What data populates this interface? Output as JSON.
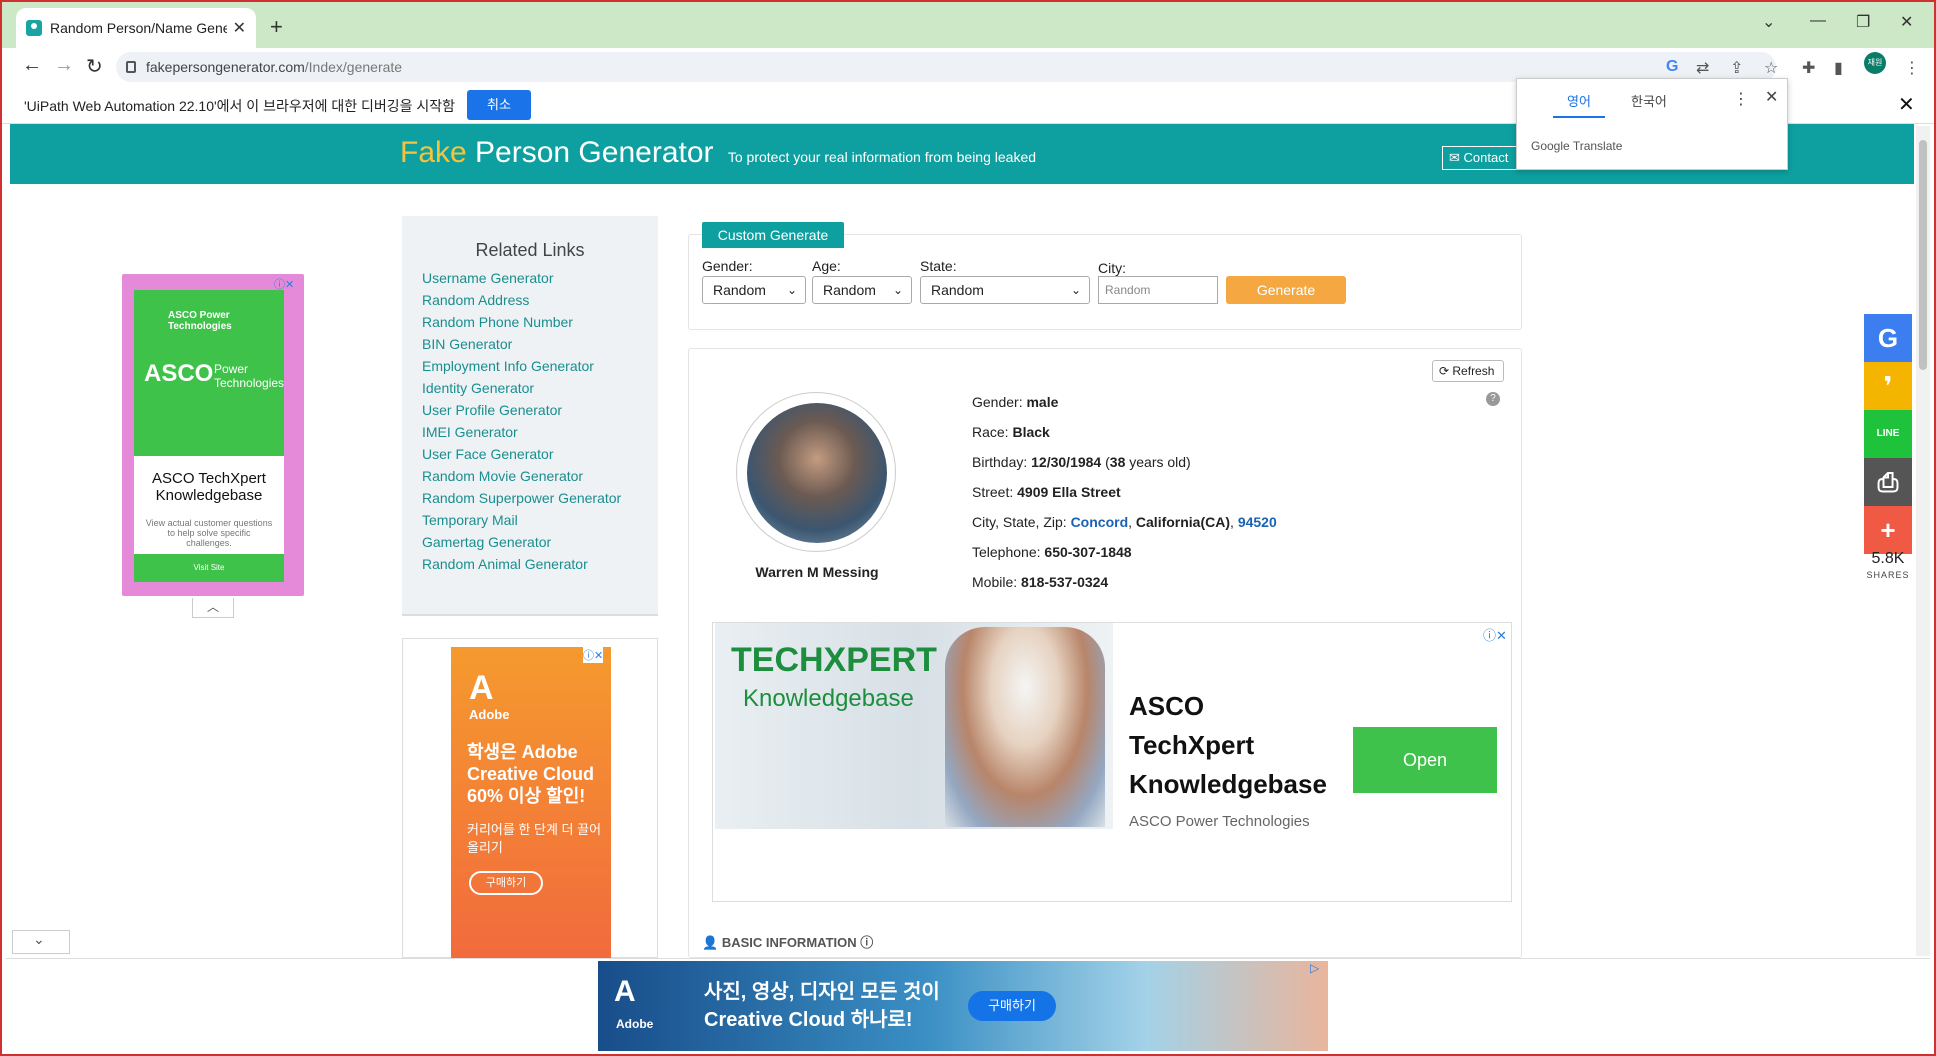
{
  "browser": {
    "tab_title": "Random Person/Name Generat",
    "tab_close": "✕",
    "new_tab": "+",
    "url_host": "fakepersongenerator.com",
    "url_path": "/Index/generate",
    "profile_label": "재원"
  },
  "debugbar": {
    "message": "'UiPath Web Automation 22.10'에서 이 브라우저에 대한 디버깅을 시작함",
    "cancel_label": "취소"
  },
  "translate": {
    "lang_source": "영어",
    "lang_target": "한국어",
    "brand": "Google Translate"
  },
  "site": {
    "brand_fake": "Fake",
    "brand_rest": "Person Generator",
    "tagline": "To protect your real information from being leaked",
    "contact_label": "Contact"
  },
  "left_ad": {
    "brand_small": "ASCO Power Technologies",
    "brand_big": "ASCO",
    "brand_power": "Power Technologies",
    "title_line1": "ASCO TechXpert",
    "title_line2": "Knowledgebase",
    "desc": "View actual customer questions to help solve specific challenges.",
    "cta": "Visit Site"
  },
  "related": {
    "heading": "Related Links",
    "links": [
      "Username Generator",
      "Random Address",
      "Random Phone Number",
      "BIN Generator",
      "Employment Info Generator",
      "Identity Generator",
      "User Profile Generator",
      "IMEI Generator",
      "User Face Generator",
      "Random Movie Generator",
      "Random Superpower Generator",
      "Temporary Mail",
      "Gamertag Generator",
      "Random Animal Generator"
    ]
  },
  "adobe_ad": {
    "brand": "Adobe",
    "headline": "학생은 Adobe Creative Cloud 60% 이상 할인!",
    "sub": "커리어를 한 단계 더 끌어올리기",
    "cta": "구매하기"
  },
  "custom": {
    "tab_label": "Custom Generate",
    "gender_label": "Gender:",
    "gender_value": "Random",
    "age_label": "Age:",
    "age_value": "Random",
    "state_label": "State:",
    "state_value": "Random",
    "city_label": "City:",
    "city_placeholder": "Random",
    "generate_label": "Generate"
  },
  "person": {
    "refresh_label": "Refresh",
    "name": "Warren M Messing",
    "gender_label": "Gender:",
    "gender": "male",
    "race_label": "Race:",
    "race": "Black",
    "birthday_label": "Birthday:",
    "birthday": "12/30/1984",
    "age_open": "(",
    "age": "38",
    "age_suffix": "years old)",
    "street_label": "Street:",
    "street": "4909 Ella Street",
    "csz_label": "City, State, Zip:",
    "city": "Concord",
    "state": "California(CA)",
    "zip": "94520",
    "telephone_label": "Telephone:",
    "telephone": "650-307-1848",
    "mobile_label": "Mobile:",
    "mobile": "818-537-0324"
  },
  "tech_ad": {
    "logo_line1": "TECHXPERT",
    "logo_line2": "Knowledgebase",
    "title": "ASCO TechXpert Knowledgebase",
    "advertiser": "ASCO Power Technologies",
    "cta": "Open"
  },
  "basic_info": "BASIC INFORMATION",
  "bottom_ad": {
    "brand": "Adobe",
    "line1": "사진, 영상, 디자인 모든 것이",
    "line2": "Creative Cloud 하나로!",
    "cta": "구매하기"
  },
  "share": {
    "count": "5.8K",
    "label": "SHARES",
    "buttons": [
      {
        "name": "google",
        "glyph": "G",
        "color": "#3c7ef0"
      },
      {
        "name": "kakao",
        "glyph": "❜",
        "color": "#f4b400"
      },
      {
        "name": "line",
        "glyph": "LINE",
        "color": "#1ec23b"
      },
      {
        "name": "print",
        "glyph": "⎙",
        "color": "#555555"
      },
      {
        "name": "more",
        "glyph": "+",
        "color": "#f05a44"
      }
    ]
  }
}
